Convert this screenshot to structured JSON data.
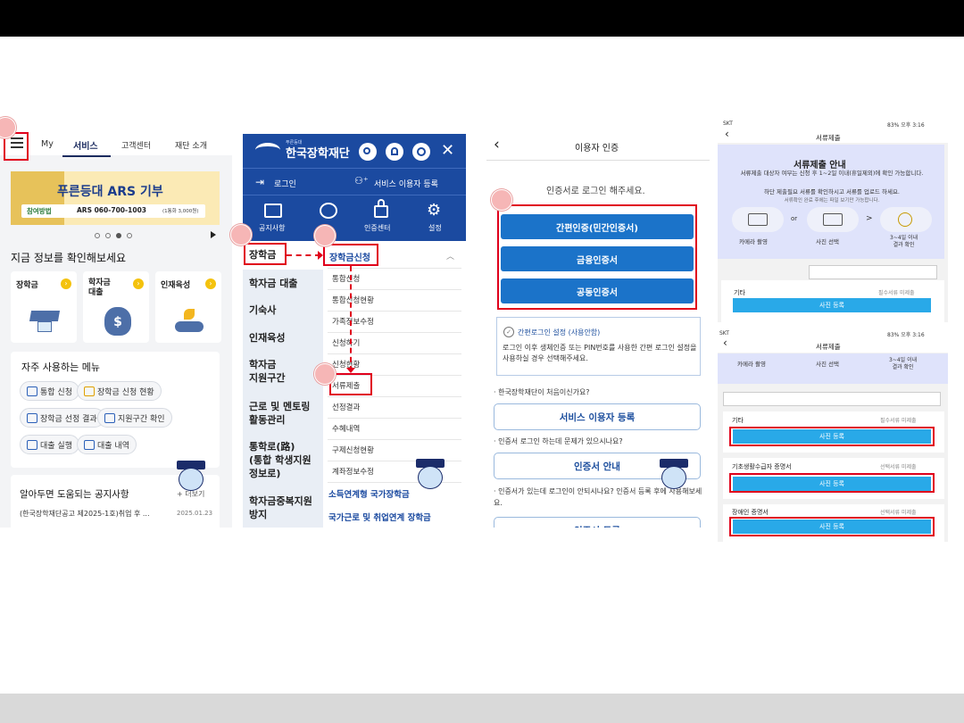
{
  "panel1": {
    "top_tabs": [
      "My",
      "서비스",
      "고객센터",
      "재단 소개"
    ],
    "banner": {
      "title": "푸른등대 ARS 기부",
      "tag": "참여방법",
      "phone": "ARS 060-700-1003",
      "fee": "(1통화 3,000원)"
    },
    "section_title": "지금 정보를 확인해보세요",
    "cards": [
      {
        "label": "장학금"
      },
      {
        "label": "학자금\n대출"
      },
      {
        "label": "인재육성"
      }
    ],
    "freq_title": "자주 사용하는 메뉴",
    "chips": [
      "통합 신청",
      "장학금 신청 현황",
      "장학금 선정 결과",
      "지원구간 확인",
      "대출 실행",
      "대출 내역"
    ],
    "notice_title": "알아두면 도움되는 공지사항",
    "notice_more": "+ 더보기",
    "notice_item": "(한국장학재단공고 제2025-1호)취업 후 ...",
    "notice_date": "2025.01.23"
  },
  "panel2": {
    "logo": "한국장학재단",
    "logo_small": "푸른등대",
    "login": "로그인",
    "register": "서비스 이용자 등록",
    "icons": [
      "공지사항",
      "",
      "인증센터",
      "설정"
    ],
    "left_menu": [
      "장학금",
      "학자금 대출",
      "기숙사",
      "인재육성",
      "학자금\n지원구간",
      "근로 및 멘토링\n활동관리",
      "통학로(路)\n(통합 학생지원\n정보로)",
      "학자금중복지원\n방지"
    ],
    "sub_header": "장학금신청",
    "sub_items": [
      "통합신청",
      "통합신청현황",
      "가족정보수정",
      "신청하기",
      "신청현황",
      "서류제출",
      "선정결과",
      "수혜내역",
      "구제신청현황",
      "계좌정보수정"
    ],
    "bottom_items": [
      "소득연계형 국가장학금",
      "국가근로 및 취업연계 장학금"
    ]
  },
  "panel3": {
    "header": "이용자 인증",
    "subtitle": "인증서로 로그인 해주세요.",
    "auth_buttons": [
      "간편인증(민간인증서)",
      "금융인증서",
      "공동인증서"
    ],
    "simple_title": "간편로그인 설정 (사용안함)",
    "simple_desc": "로그인 이후 생체인증 또는 PIN번호를 사용한 간편 로그인 설정을 사용하실 경우 선택해주세요.",
    "q1": "· 한국장학재단이 처음이신가요?",
    "btn1": "서비스 이용자 등록",
    "q2": "· 인증서 로그인 하는데 문제가 있으시나요?",
    "btn2": "인증서 안내",
    "q3": "· 인증서가 있는데 로그인이 안되시나요? 인증서 등록 후에 사용해보세요.",
    "btn3": "인증서 등록"
  },
  "panel4": {
    "status_left": "SKT",
    "status_right": "83% 오후 3:16",
    "header": "서류제출",
    "guide_title": "서류제출 안내",
    "guide_text1": "서류제출 대상자 여부는 신청 후 1~2일 이내(휴일제외)에 확인 가능합니다.",
    "guide_text2": "하단 제출필요 서류를 확인하시고 서류를 업로드 하세요.",
    "guide_text3": "서류확인 완료 후에는 파일 보기만 가능합니다.",
    "steps": [
      "카메라 촬영",
      "사진 선택",
      "3~4일 이내\n결과 확인"
    ],
    "or": "or",
    "gt": ">",
    "docs": [
      {
        "name": "기타",
        "status": "필수서류 미제출",
        "btn": "사진 등록"
      },
      {
        "name": "기초생활수급자 증명서",
        "status": "선택서류 미제출",
        "btn": "사진 등록"
      },
      {
        "name": "장애인 증명서",
        "status": "선택서류 미제출",
        "btn": "사진 등록"
      }
    ]
  },
  "colors": {
    "accent": "#1b73c9",
    "highlight": "#e0001b",
    "step_marker": "#f6b6b6"
  }
}
